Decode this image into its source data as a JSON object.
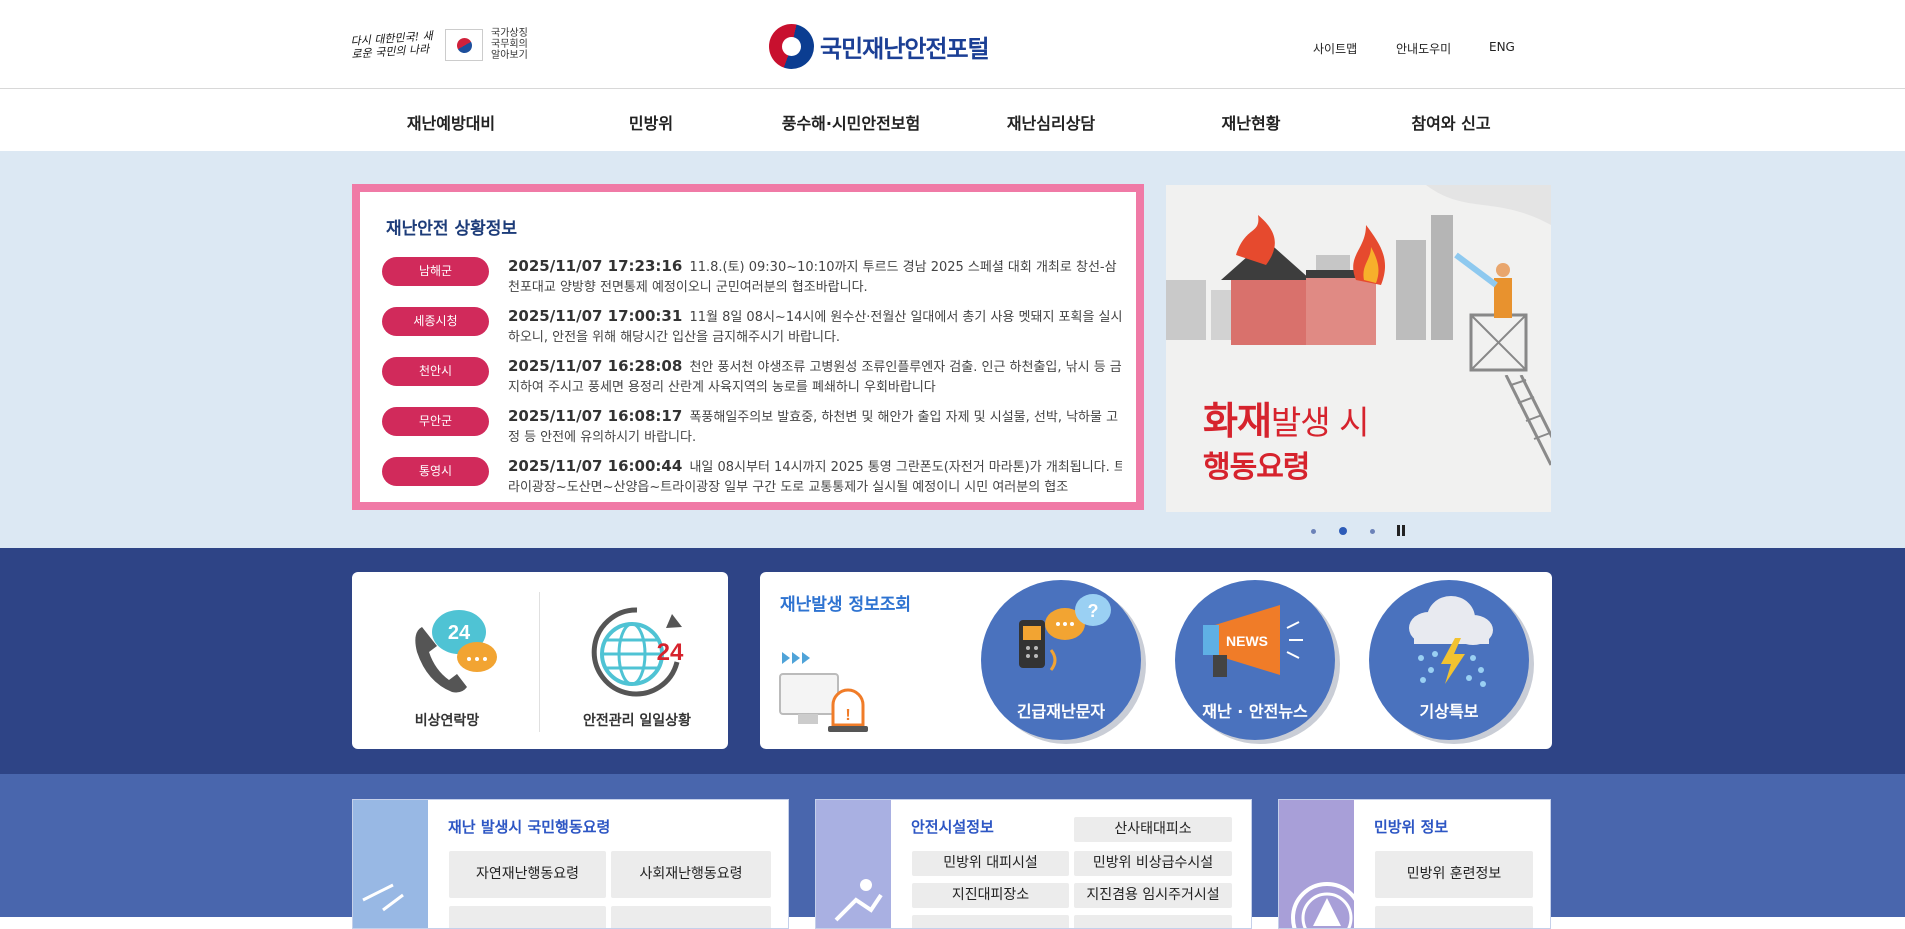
{
  "header": {
    "slogan": "다시 대한민국! 새로운 국민의 나라",
    "gov_link": [
      "국가상징",
      "국무회의",
      "알아보기"
    ],
    "site_title": "국민재난안전포털",
    "util_links": [
      "사이트맵",
      "안내도우미",
      "ENG"
    ]
  },
  "gnb": [
    "재난예방대비",
    "민방위",
    "풍수해·시민안전보험",
    "재난심리상담",
    "재난현황",
    "참여와 신고"
  ],
  "situation": {
    "title": "재난안전 상황정보",
    "items": [
      {
        "region": "남해군",
        "time": "2025/11/07 17:23:16",
        "text": "11.8.(토) 09:30~10:10까지 투르드 경남 2025 스페셜 대회 개최로 창선-삼천포대교 양방향 전면통제 예정이오니 군민여러분의 협조바랍니다."
      },
      {
        "region": "세종시청",
        "time": "2025/11/07 17:00:31",
        "text": "11월 8일 08시~14시에 원수산·전월산 일대에서 총기 사용 멧돼지 포획을 실시하오니, 안전을 위해 해당시간 입산을 금지해주시기 바랍니다."
      },
      {
        "region": "천안시",
        "time": "2025/11/07 16:28:08",
        "text": "천안 풍서천 야생조류 고병원성 조류인플루엔자 검출. 인근 하천출입, 낚시 등 금지하여 주시고 풍세면 용정리 산란계 사육지역의 농로를 폐쇄하니 우회바랍니다"
      },
      {
        "region": "무안군",
        "time": "2025/11/07 16:08:17",
        "text": "폭풍해일주의보 발효중, 하천변 및 해안가 출입 자제 및 시설물, 선박, 낙하물 고정 등 안전에 유의하시기 바랍니다."
      },
      {
        "region": "통영시",
        "time": "2025/11/07 16:00:44",
        "text": "내일 08시부터 14시까지 2025 통영 그란폰도(자전거 마라톤)가 개최됩니다. 트라이광장~도산면~산양읍~트라이광장 일부 구간 도로 교통통제가 실시될 예정이니 시민 여러분의 협조"
      }
    ]
  },
  "banner": {
    "line1_big": "화재",
    "line1_rest": "발생 시",
    "line2": "행동요령"
  },
  "quick": {
    "left": [
      "비상연락망",
      "안전관리 일일상황"
    ],
    "info_title": "재난발생 정보조회",
    "circles": [
      "긴급재난문자",
      "재난 · 안전뉴스",
      "기상특보"
    ]
  },
  "cards": [
    {
      "title": "재난 발생시 국민행동요령",
      "items": [
        "자연재난행동요령",
        "사회재난행동요령"
      ]
    },
    {
      "title": "안전시설정보",
      "items": [
        "산사태대피소",
        "민방위 대피시설",
        "민방위 비상급수시설",
        "지진대피장소",
        "지진겸용 임시주거시설"
      ]
    },
    {
      "title": "민방위 정보",
      "items": [
        "민방위 훈련정보"
      ]
    }
  ],
  "colors": {
    "primary": "#1b3f95",
    "alert_pink": "#f07aa6",
    "badge": "#d12a5b",
    "band": "#2e4486",
    "lower": "#4966ad"
  }
}
